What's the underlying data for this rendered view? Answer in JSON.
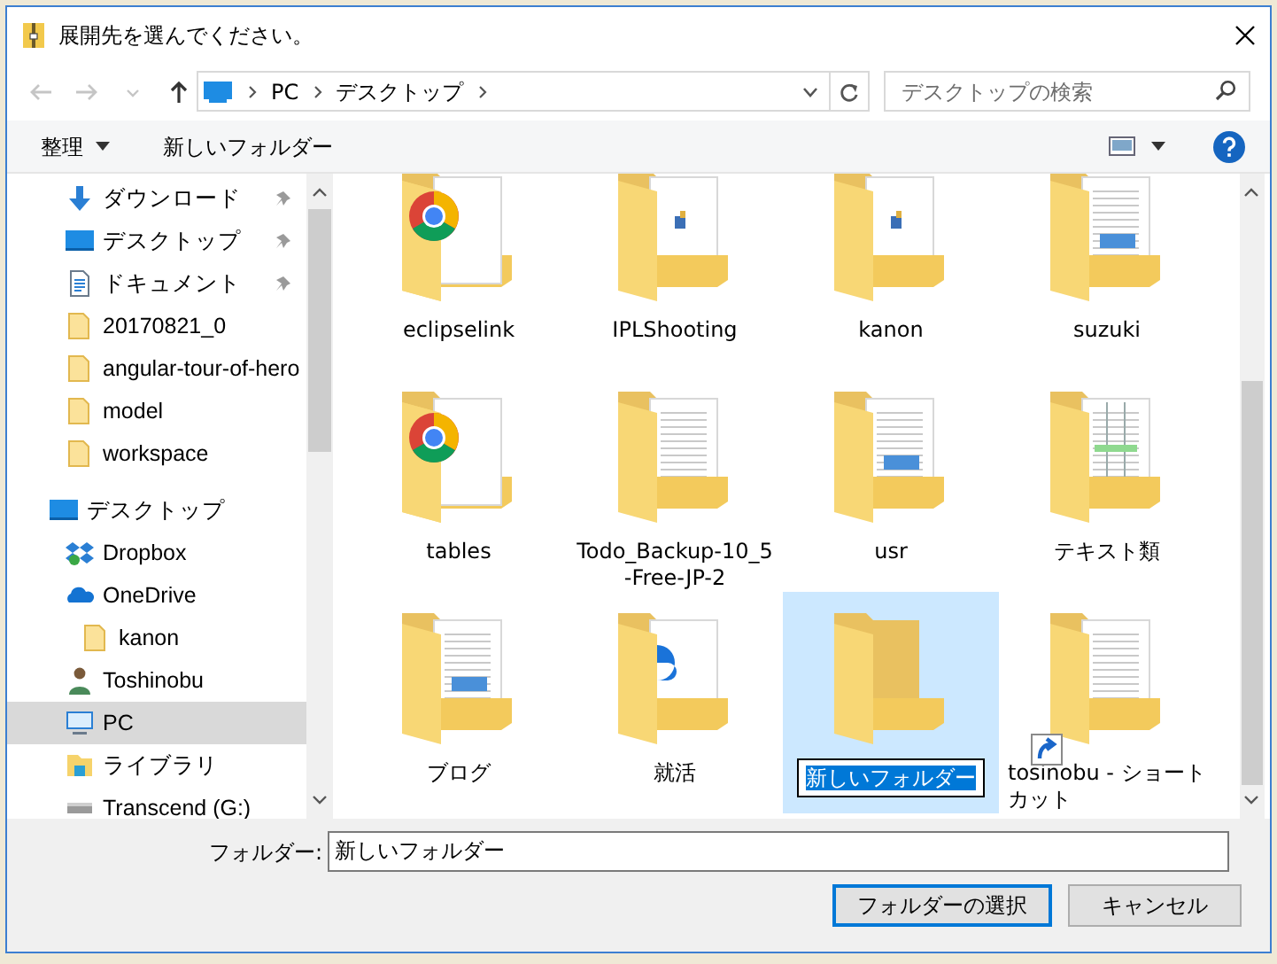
{
  "window": {
    "title": "展開先を選んでください。"
  },
  "nav_buttons": [
    {
      "kind": "back",
      "disabled": true
    },
    {
      "kind": "forward",
      "disabled": true
    },
    {
      "kind": "recent",
      "disabled": true
    },
    {
      "kind": "up",
      "disabled": false
    }
  ],
  "address": {
    "path": [
      "PC",
      "デスクトップ"
    ]
  },
  "search": {
    "placeholder": "デスクトップの検索"
  },
  "toolbar": {
    "organize": "整理",
    "new_folder": "新しいフォルダー"
  },
  "sidebar": {
    "quick_access": [
      {
        "label": "ダウンロード",
        "kind": "download",
        "pinned": true,
        "selected": false
      },
      {
        "label": "デスクトップ",
        "kind": "desktop",
        "pinned": true,
        "selected": false
      },
      {
        "label": "ドキュメント",
        "kind": "document",
        "pinned": true,
        "selected": false
      },
      {
        "label": "20170821_0",
        "kind": "folder",
        "pinned": false,
        "selected": false
      },
      {
        "label": "angular-tour-of-hero",
        "kind": "folder",
        "pinned": false,
        "selected": false
      },
      {
        "label": "model",
        "kind": "folder",
        "pinned": false,
        "selected": false
      },
      {
        "label": "workspace",
        "kind": "folder",
        "pinned": false,
        "selected": false
      }
    ],
    "tree": [
      {
        "label": "デスクトップ",
        "kind": "desktop",
        "selected": false,
        "children": [
          {
            "label": "Dropbox",
            "kind": "dropbox",
            "selected": false
          },
          {
            "label": "OneDrive",
            "kind": "onedrive",
            "selected": false,
            "children": [
              {
                "label": "kanon",
                "kind": "folder",
                "selected": false
              }
            ]
          },
          {
            "label": "Toshinobu",
            "kind": "user",
            "selected": false
          },
          {
            "label": "PC",
            "kind": "pc",
            "selected": true
          },
          {
            "label": "ライブラリ",
            "kind": "library",
            "selected": false
          },
          {
            "label": "Transcend (G:)",
            "kind": "drive",
            "selected": false
          }
        ]
      }
    ]
  },
  "items": [
    {
      "name": "eclipselink",
      "kind": "chrome",
      "selected": false,
      "editing": false,
      "shortcut": false
    },
    {
      "name": "IPLShooting",
      "kind": "app",
      "selected": false,
      "editing": false,
      "shortcut": false
    },
    {
      "name": "kanon",
      "kind": "app",
      "selected": false,
      "editing": false,
      "shortcut": false
    },
    {
      "name": "suzuki",
      "kind": "images",
      "selected": false,
      "editing": false,
      "shortcut": false
    },
    {
      "name": "tables",
      "kind": "chrome",
      "selected": false,
      "editing": false,
      "shortcut": false
    },
    {
      "name": "Todo_Backup-10_5-Free-JP-2",
      "kind": "document",
      "selected": false,
      "editing": false,
      "shortcut": false
    },
    {
      "name": "usr",
      "kind": "images",
      "selected": false,
      "editing": false,
      "shortcut": false
    },
    {
      "name": "テキスト類",
      "kind": "sheet",
      "selected": false,
      "editing": false,
      "shortcut": false
    },
    {
      "name": "ブログ",
      "kind": "images",
      "selected": false,
      "editing": false,
      "shortcut": false
    },
    {
      "name": "就活",
      "kind": "edge",
      "selected": false,
      "editing": false,
      "shortcut": false
    },
    {
      "name": "新しいフォルダー",
      "kind": "empty",
      "selected": true,
      "editing": true,
      "shortcut": false
    },
    {
      "name": "tosinobu - ショートカット",
      "kind": "document",
      "selected": false,
      "editing": false,
      "shortcut": true
    }
  ],
  "footer": {
    "folder_label": "フォルダー:",
    "folder_value": "新しいフォルダー",
    "buttons": [
      {
        "label": "フォルダーの選択",
        "default": true
      },
      {
        "label": "キャンセル",
        "default": false
      }
    ]
  }
}
